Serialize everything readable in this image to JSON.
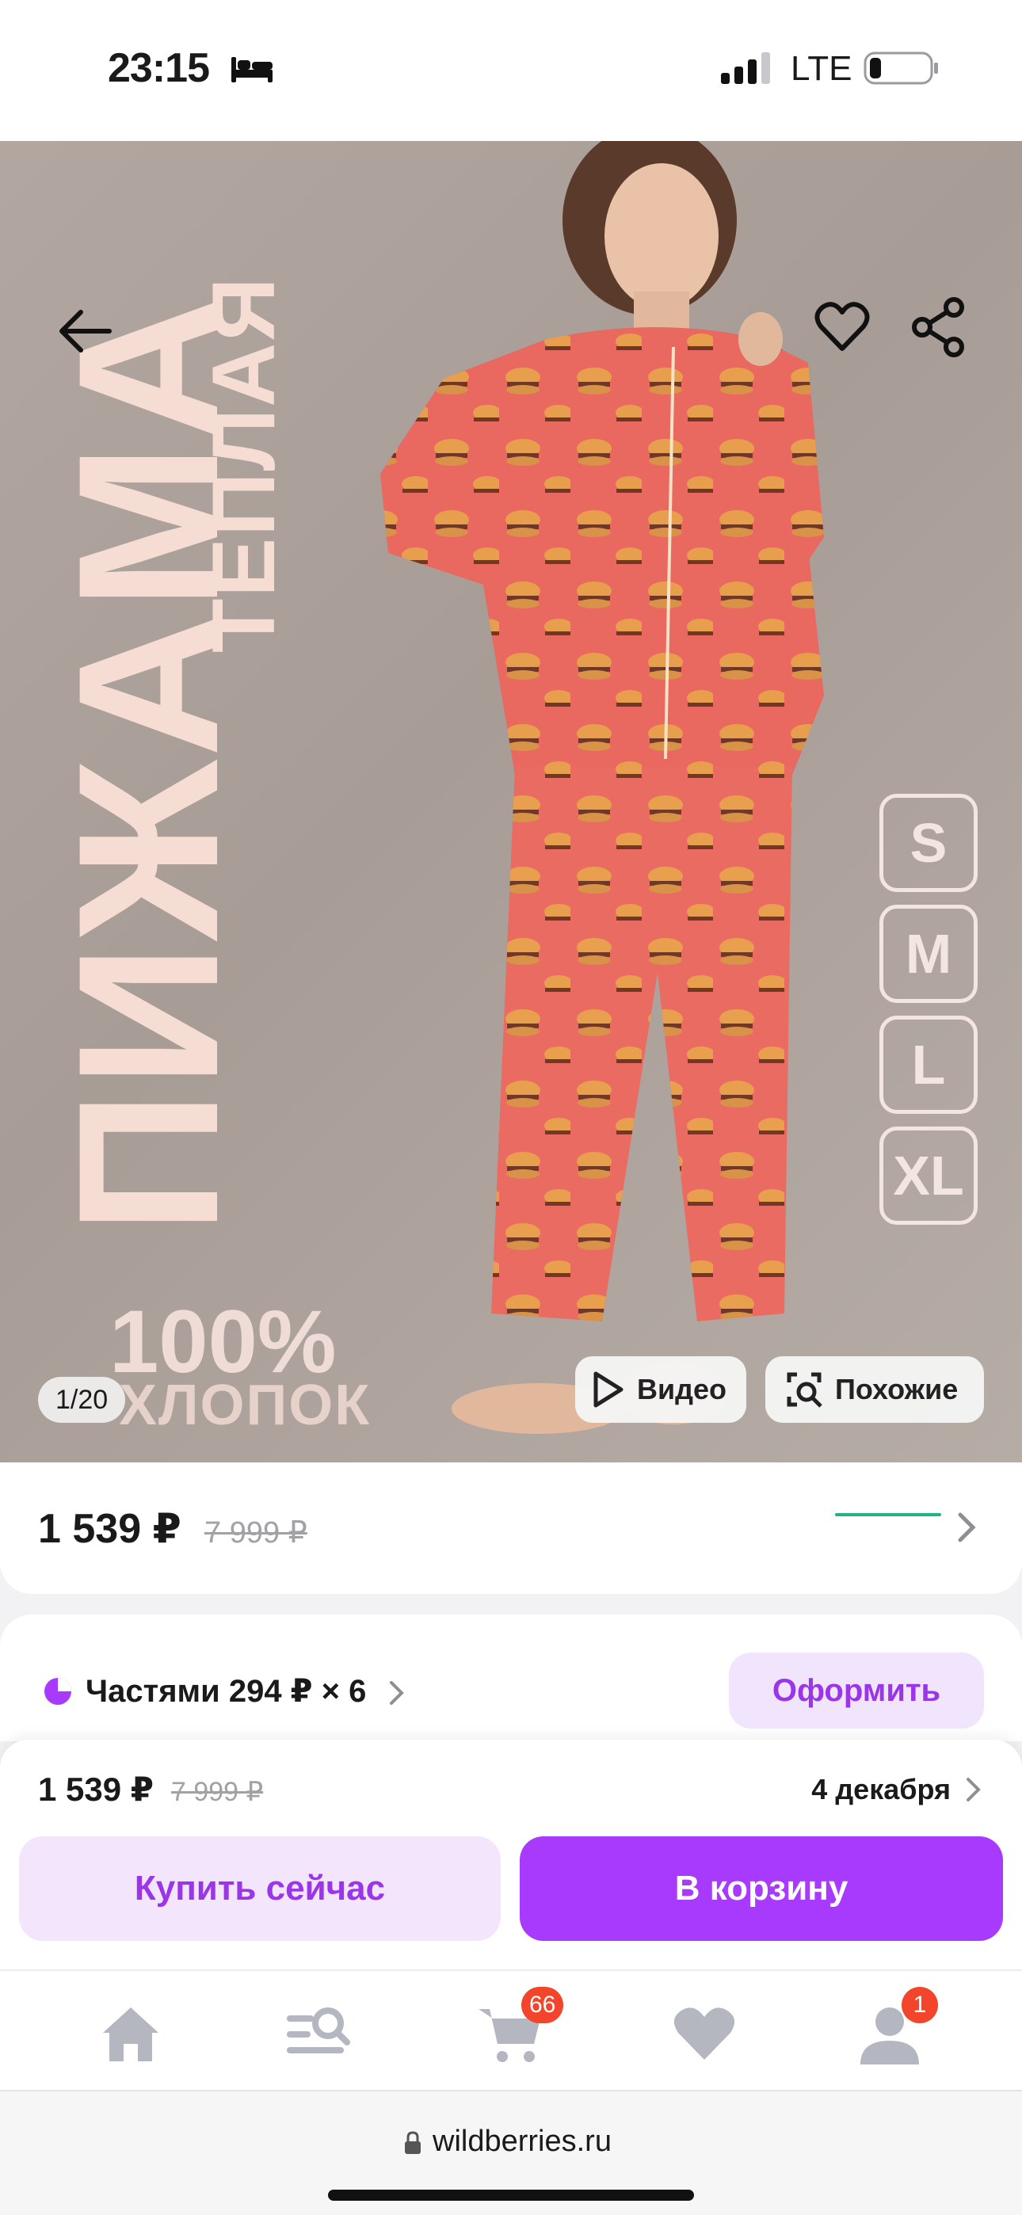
{
  "status_bar": {
    "time": "23:15",
    "network": "LTE",
    "icons": [
      "bed-icon",
      "signal-icon",
      "battery-icon"
    ]
  },
  "hero": {
    "title": "ПИЖАМА",
    "subtitle": "ТЕПЛАЯ",
    "cotton_percent": "100%",
    "cotton_word": "ХЛОПОК",
    "sizes": [
      "S",
      "M",
      "L",
      "XL"
    ],
    "page_counter": "1/20",
    "video_label": "Видео",
    "similar_label": "Похожие",
    "icons": [
      "back-arrow-icon",
      "heart-icon",
      "share-icon",
      "play-icon",
      "image-search-icon"
    ]
  },
  "price": {
    "current": "1 539 ₽",
    "old": "7 999 ₽"
  },
  "installments": {
    "text": "Частями 294 ₽ × 6",
    "button": "Оформить"
  },
  "buy_sheet": {
    "price": "1 539 ₽",
    "old_price": "7 999 ₽",
    "delivery_date": "4 декабря",
    "buy_now": "Купить сейчас",
    "add_to_cart": "В корзину"
  },
  "tab_bar": {
    "items": [
      {
        "icon": "home-icon"
      },
      {
        "icon": "catalog-search-icon"
      },
      {
        "icon": "cart-icon",
        "badge": "66"
      },
      {
        "icon": "heart-icon"
      },
      {
        "icon": "profile-icon",
        "badge": "1"
      }
    ]
  },
  "browser": {
    "url": "wildberries.ru"
  },
  "colors": {
    "accent": "#a73afd",
    "accent_light": "#f3e6fc",
    "badge": "#f2452c",
    "price_line": "#1fb385"
  }
}
